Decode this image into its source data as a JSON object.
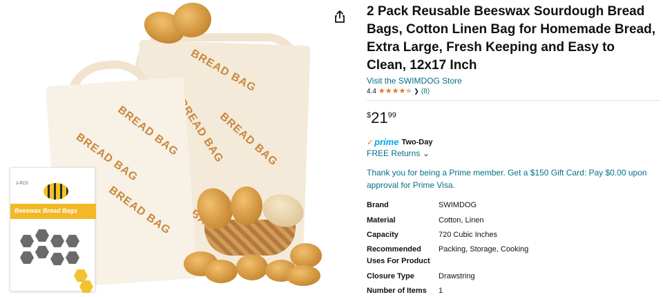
{
  "product": {
    "title": "2 Pack Reusable Beeswax Sourdough Bread Bags, Cotton Linen Bag for Homemade Bread, Extra Large, Fresh Keeping and Easy to Clean, 12x17 Inch",
    "store_link": "Visit the SWIMDOG Store",
    "rating": "4.4",
    "stars_value": 4.4,
    "rating_count": "(8)",
    "price": {
      "symbol": "$",
      "whole": "21",
      "fraction": "99"
    },
    "prime": {
      "word": "prime",
      "label": "Two-Day"
    },
    "free_returns": "FREE Returns",
    "promo": "Thank you for being a Prime member. Get a $150 Gift Card: Pay $0.00 upon approval for Prime Visa."
  },
  "specs": [
    {
      "key": "Brand",
      "value": "SWIMDOG"
    },
    {
      "key": "Material",
      "value": "Cotton, Linen"
    },
    {
      "key": "Capacity",
      "value": "720 Cubic Inches"
    },
    {
      "key": "Recommended Uses For Product",
      "value": "Packing, Storage, Cooking"
    },
    {
      "key": "Closure Type",
      "value": "Drawstring"
    },
    {
      "key": "Number of Items",
      "value": "1"
    }
  ],
  "image": {
    "bag_print": "BREAD BAG",
    "box_title": "Beeswax Bread Bags",
    "box_pcs": "2-PCS"
  },
  "colors": {
    "link": "#007185",
    "star": "#de7921",
    "prime_blue": "#00a8e1",
    "prime_check": "#f08804",
    "box_band": "#f2b826"
  },
  "icons": {
    "share": "share-icon",
    "star": "star-icon",
    "chevron": "chevron-down-icon",
    "prime_check": "checkmark-icon"
  }
}
